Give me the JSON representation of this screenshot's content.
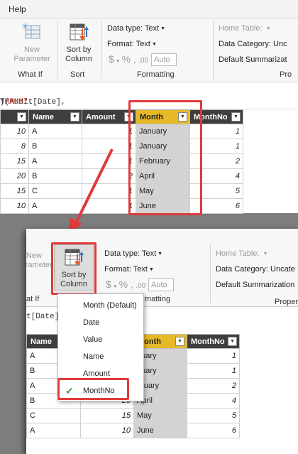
{
  "menu": {
    "help": "Help"
  },
  "ribbon_top": {
    "new_parameter": "New\nParameter",
    "sort_by_column": "Sort by\nColumn",
    "group_what_if": "What If",
    "group_sort": "Sort",
    "group_formatting": "Formatting",
    "group_properties": "Pro",
    "data_type": "Data type: Text",
    "format": "Format: Text",
    "auto": "Auto",
    "home_table": "Home Table:",
    "data_category": "Data Category: Unc",
    "default_summarization": "Default Summarizat"
  },
  "formula_top": {
    "prefix": "T(Audit[Date],",
    "string": "\"MMMM\"",
    "suffix": ")"
  },
  "table_top": {
    "columns": [
      "",
      "Name",
      "Amount",
      "Month",
      "MonthNo"
    ],
    "rows": [
      [
        "10",
        "A",
        "1",
        "January",
        "1"
      ],
      [
        "8",
        "B",
        "1",
        "January",
        "1"
      ],
      [
        "15",
        "A",
        "1",
        "February",
        "2"
      ],
      [
        "20",
        "B",
        "2",
        "April",
        "4"
      ],
      [
        "15",
        "C",
        "1",
        "May",
        "5"
      ],
      [
        "10",
        "A",
        "1",
        "June",
        "6"
      ]
    ]
  },
  "ribbon_bottom": {
    "new_parameter": "New\nParameter",
    "sort_by_column": "Sort by\nColumn",
    "group_what_if": "at If",
    "group_formatting": "matting",
    "group_properties": "Proper",
    "data_type": "Data type: Text",
    "format": "Format: Text",
    "auto": "Auto",
    "home_table": "Home Table:",
    "data_category": "Data Category: Uncate",
    "default_summarization": "Default Summarization"
  },
  "formula_bottom": {
    "text": "t[Date]"
  },
  "dropdown": {
    "items": [
      "Month (Default)",
      "Date",
      "Value",
      "Name",
      "Amount",
      "MonthNo"
    ],
    "checked": "MonthNo"
  },
  "table_bottom": {
    "columns": [
      "Name",
      "",
      "Month",
      "MonthNo"
    ],
    "rows": [
      [
        "A",
        "",
        "nuary",
        "1"
      ],
      [
        "B",
        "",
        "nuary",
        "1"
      ],
      [
        "A",
        "",
        "bruary",
        "2"
      ],
      [
        "B",
        "20",
        "April",
        "4"
      ],
      [
        "C",
        "15",
        "May",
        "5"
      ],
      [
        "A",
        "10",
        "June",
        "6"
      ]
    ]
  },
  "colors": {
    "accent_red": "#e03a3a",
    "month_header": "#e7b926",
    "header_dark": "#3e3e3e",
    "check_green": "#4ea454"
  }
}
